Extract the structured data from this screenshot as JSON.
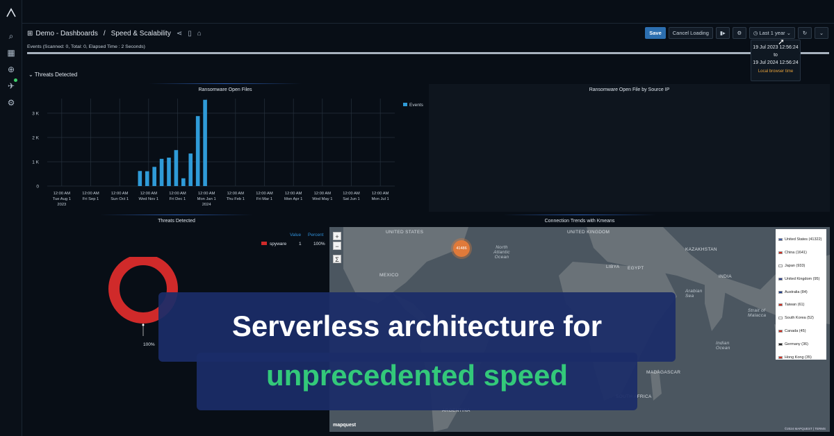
{
  "breadcrumb": {
    "root": "Demo - Dashboards",
    "separator": "/",
    "current": "Speed & Scalability"
  },
  "toolbar": {
    "save": "Save",
    "cancel": "Cancel Loading",
    "time_range": "Last 1 year"
  },
  "events_status": "Events (Scanned: 0, Total: 0, Elapsed Time : 2 Seconds)",
  "loading_progress": 1.0,
  "time_popover": {
    "from": "19 Jul 2023 12:56:24",
    "to_word": "to",
    "to": "19 Jul 2024 12:56:24",
    "timezone": "Local browser time"
  },
  "section_title": "Threats Detected",
  "panels": {
    "ransomware_files": "Ransomware Open Files",
    "ransomware_by_ip": "Ransomware Open File by Source IP",
    "threats_detected": "Threats Detected",
    "connection_trends": "Connection Trends with Kmeans"
  },
  "chart_data": {
    "type": "bar",
    "title": "Ransomware Open Files",
    "xlabel": "",
    "ylabel": "",
    "ylim": [
      0,
      3600
    ],
    "yticks": [
      "0",
      "1 K",
      "2 K",
      "3 K"
    ],
    "ytick_values": [
      0,
      1000,
      2000,
      3000
    ],
    "xticks": [
      [
        "12:00 AM",
        "Tue Aug 1",
        "2023"
      ],
      [
        "12:00 AM",
        "Fri Sep 1",
        ""
      ],
      [
        "12:00 AM",
        "Sun Oct 1",
        ""
      ],
      [
        "12:00 AM",
        "Wed Nov 1",
        ""
      ],
      [
        "12:00 AM",
        "Fri Dec 1",
        ""
      ],
      [
        "12:00 AM",
        "Mon Jan 1",
        "2024"
      ],
      [
        "12:00 AM",
        "Thu Feb 1",
        ""
      ],
      [
        "12:00 AM",
        "Fri Mar 1",
        ""
      ],
      [
        "12:00 AM",
        "Mon Apr 1",
        ""
      ],
      [
        "12:00 AM",
        "Wed May 1",
        ""
      ],
      [
        "12:00 AM",
        "Sat Jun 1",
        ""
      ],
      [
        "12:00 AM",
        "Mon Jul 1",
        ""
      ]
    ],
    "series": [
      {
        "name": "Events",
        "color": "#2f9bd8",
        "points": [
          {
            "x": 3.2,
            "value": 620
          },
          {
            "x": 3.45,
            "value": 610
          },
          {
            "x": 3.7,
            "value": 790
          },
          {
            "x": 3.95,
            "value": 1120
          },
          {
            "x": 4.2,
            "value": 1170
          },
          {
            "x": 4.45,
            "value": 1480
          },
          {
            "x": 4.7,
            "value": 320
          },
          {
            "x": 4.95,
            "value": 1340
          },
          {
            "x": 5.2,
            "value": 2880
          },
          {
            "x": 5.45,
            "value": 3550
          }
        ]
      }
    ],
    "legend": "top-right",
    "grid": true
  },
  "donut": {
    "legend_headers": {
      "value": "Value",
      "percent": "Percent"
    },
    "rows": [
      {
        "label": "spyware",
        "value": "1",
        "percent": "100%",
        "color": "#d02a2a"
      }
    ],
    "slice_label": "100%"
  },
  "map": {
    "cluster_count": "41486",
    "labels": [
      "UNITED STATES",
      "MEXICO",
      "North Atlantic Ocean",
      "LIBYA",
      "EGYPT",
      "Arabian Sea",
      "Indian Ocean",
      "MADAGASCAR",
      "UNITED KINGDOM",
      "KAZAKHSTAN",
      "Strait of Malacca",
      "ARGENTINA",
      "SOUTH AFRICA",
      "INDIA"
    ],
    "legend": [
      "United States (41322)",
      "China (1641)",
      "Japan (933)",
      "United Kingdom (95)",
      "Australia (84)",
      "Taiwan (61)",
      "South Korea (52)",
      "Canada (45)",
      "Germany (36)",
      "Hong Kong (35)"
    ],
    "attribution": "©2024 MAPQUEST | TERMS",
    "logo": "mapquest"
  },
  "headline": {
    "line1": "Serverless architecture for",
    "line2": "unprecedented speed"
  },
  "colors": {
    "accent": "#2c6fb0",
    "headline_green": "#33c97a",
    "banner_bg": "#1b2c68"
  }
}
